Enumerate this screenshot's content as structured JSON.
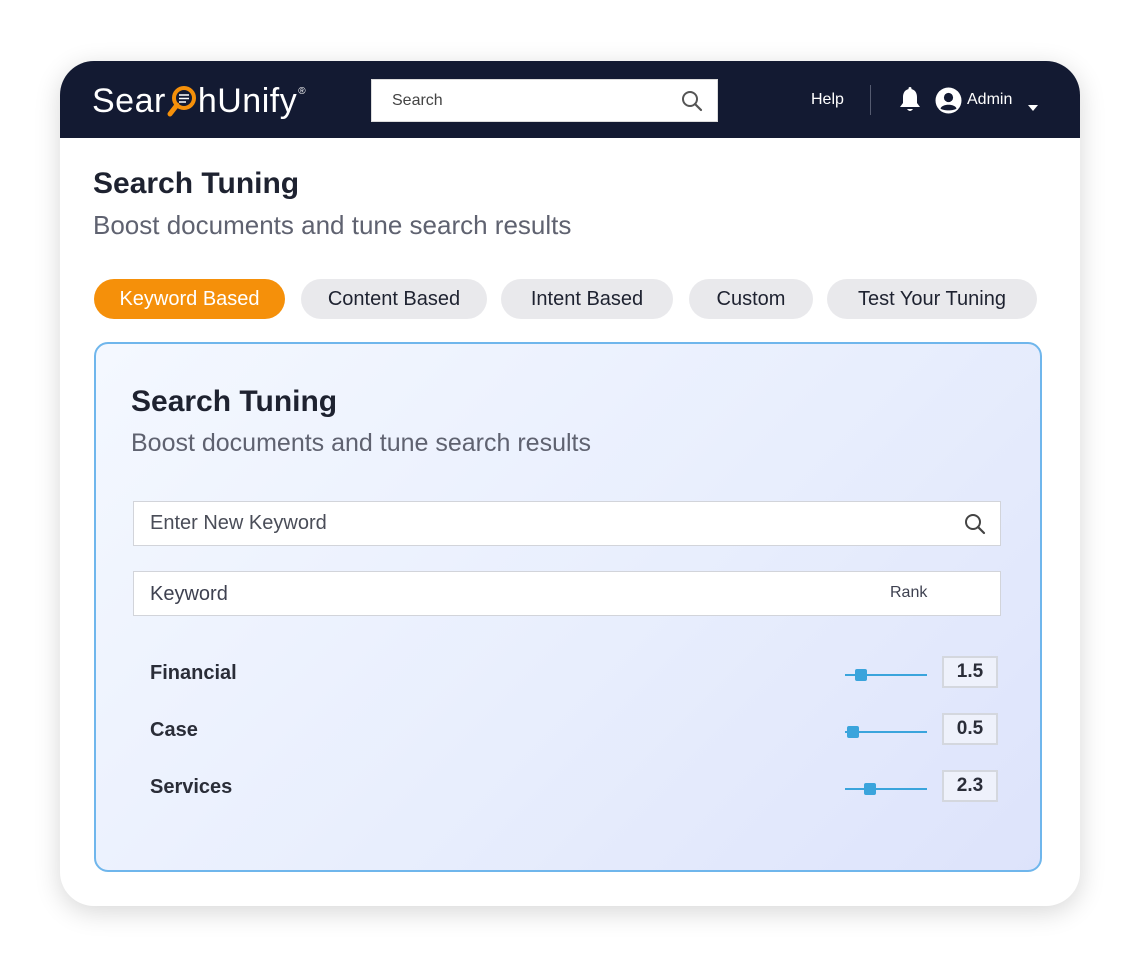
{
  "brand": {
    "logo_text_left": "Sear",
    "logo_text_right": "hUnify",
    "logo_registered": "®",
    "accent_color": "#f5900a",
    "topbar_color": "#131a32"
  },
  "header": {
    "search_placeholder": "Search",
    "help_label": "Help",
    "user_label": "Admin",
    "icons": [
      "search-icon",
      "bell-icon",
      "user-avatar-icon",
      "caret-down-icon"
    ]
  },
  "page": {
    "title": "Search Tuning",
    "subtitle": "Boost documents and tune search results"
  },
  "tabs": [
    {
      "label": "Keyword Based",
      "active": true
    },
    {
      "label": "Content Based",
      "active": false
    },
    {
      "label": "Intent Based",
      "active": false
    },
    {
      "label": "Custom",
      "active": false
    },
    {
      "label": "Test Your Tuning",
      "active": false
    }
  ],
  "card": {
    "title": "Search Tuning",
    "subtitle": "Boost documents and tune search results",
    "keyword_input_placeholder": "Enter New Keyword",
    "table_headers": {
      "keyword": "Keyword",
      "rank": "Rank"
    },
    "rows": [
      {
        "keyword": "Financial",
        "rank": "1.5",
        "slider_fraction": 0.2
      },
      {
        "keyword": "Case",
        "rank": "0.5",
        "slider_fraction": 0.1
      },
      {
        "keyword": "Services",
        "rank": "2.3",
        "slider_fraction": 0.3
      }
    ]
  }
}
